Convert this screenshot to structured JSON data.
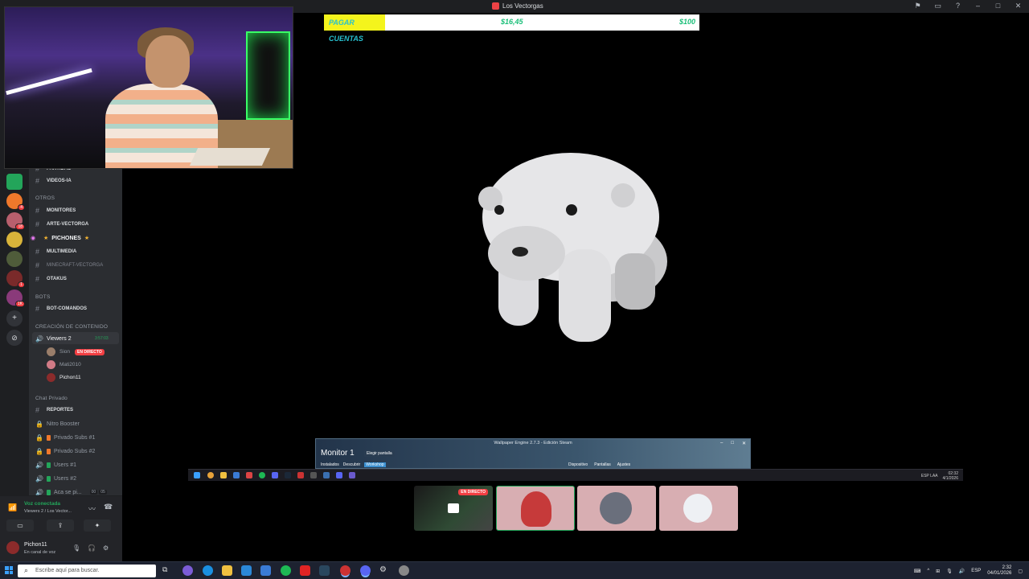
{
  "window": {
    "title": "Los Vectorgas"
  },
  "overlay": {
    "label": "PAGAR CUENTAS",
    "current": "$16,45",
    "goal": "$100"
  },
  "channels": {
    "partial_top": "PARTIDAS",
    "videos": "VIDEOS-IA",
    "cat_otros": "OTROS",
    "monitores": "MONITORES",
    "arte": "ARTE-VECTORGA",
    "pichones": "PICHONES",
    "multimedia": "MULTIMEDIA",
    "minecraft": "MINECRAFT-VECTORGA",
    "otakus": "OTAKUS",
    "cat_bots": "BOTS",
    "bot_comandos": "BOT-COMANDOS",
    "cat_creacion": "CREACIÓN DE CONTENIDO",
    "viewers": "Viewers 2",
    "viewers_timer": "3:57:03",
    "cat_privado": "Chat Privado",
    "reportes": "REPORTES",
    "nitro": "Nitro Booster",
    "subs1": "Privado Subs #1",
    "subs2": "Privado Subs #2",
    "users1": "Users #1",
    "users2": "Users #2",
    "aca": "Aca se pi...",
    "aca_count_a": "00",
    "aca_count_b": "05"
  },
  "members": [
    {
      "name": "Sion",
      "live": "EN DIRECTO"
    },
    {
      "name": "Mati2010"
    },
    {
      "name": "Pichon11"
    }
  ],
  "voice": {
    "status": "Voz conectada",
    "channel": "Viewers 2 / Los Vector..."
  },
  "user": {
    "name": "Pichon11",
    "status": "En canal de voz"
  },
  "wpe": {
    "title": "Wallpaper Engine 2.7.3 - Edición Steam",
    "monitor": "Monitor 1",
    "choose": "Elegir pantalla",
    "tabs": [
      "Instalados",
      "Descubrir",
      "Workshop"
    ],
    "right_tabs": [
      "Dispositivo",
      "Pantallas",
      "Ajustes"
    ]
  },
  "inner_tray": {
    "lang": "ESP LAA",
    "time": "02:32",
    "date": "4/1/2026"
  },
  "tiles": {
    "live": "EN DIRECTO"
  },
  "taskbar": {
    "search_placeholder": "Escribe aquí para buscar.",
    "lang": "ESP",
    "time": "2:32",
    "date": "04/01/2026"
  }
}
